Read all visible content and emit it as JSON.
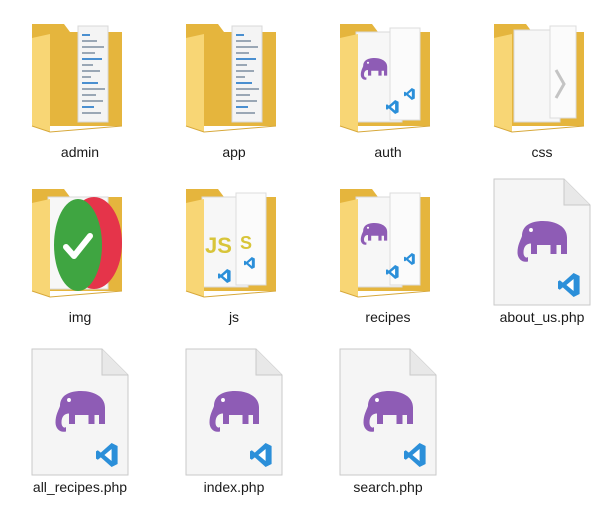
{
  "explorer": {
    "items": [
      {
        "name": "admin",
        "kind": "folder",
        "preview": "docs",
        "icon": "folder-icon"
      },
      {
        "name": "app",
        "kind": "folder",
        "preview": "docs",
        "icon": "folder-icon"
      },
      {
        "name": "auth",
        "kind": "folder",
        "preview": "php",
        "icon": "folder-icon"
      },
      {
        "name": "css",
        "kind": "folder",
        "preview": "css",
        "icon": "folder-icon"
      },
      {
        "name": "img",
        "kind": "folder",
        "preview": "img",
        "icon": "folder-icon"
      },
      {
        "name": "js",
        "kind": "folder",
        "preview": "js",
        "icon": "folder-icon"
      },
      {
        "name": "recipes",
        "kind": "folder",
        "preview": "php",
        "icon": "folder-icon"
      },
      {
        "name": "about_us.php",
        "kind": "file",
        "icon": "php-file-icon"
      },
      {
        "name": "all_recipes.php",
        "kind": "file",
        "icon": "php-file-icon"
      },
      {
        "name": "index.php",
        "kind": "file",
        "icon": "php-file-icon"
      },
      {
        "name": "search.php",
        "kind": "file",
        "icon": "php-file-icon"
      }
    ]
  },
  "colors": {
    "folder_back": "#e5b53d",
    "folder_front": "#f8d675",
    "elephant": "#8e5cb5",
    "vscode_blue": "#2b8fd9",
    "check_green": "#3fa541",
    "check_red": "#e5344a"
  }
}
